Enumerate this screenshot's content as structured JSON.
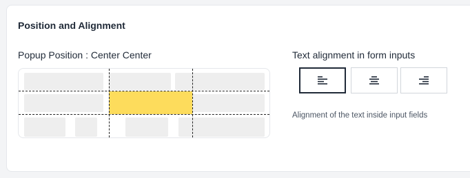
{
  "section": {
    "title": "Position and Alignment"
  },
  "popup_position": {
    "label": "Popup Position : Center Center",
    "selected": "center-center",
    "highlight_color": "#fddc5c"
  },
  "text_alignment": {
    "label": "Text alignment in form inputs",
    "options": [
      {
        "value": "left",
        "icon": "align-left-icon",
        "selected": true
      },
      {
        "value": "center",
        "icon": "align-center-icon",
        "selected": false
      },
      {
        "value": "right",
        "icon": "align-right-icon",
        "selected": false
      }
    ],
    "help": "Alignment of the text inside input fields"
  }
}
